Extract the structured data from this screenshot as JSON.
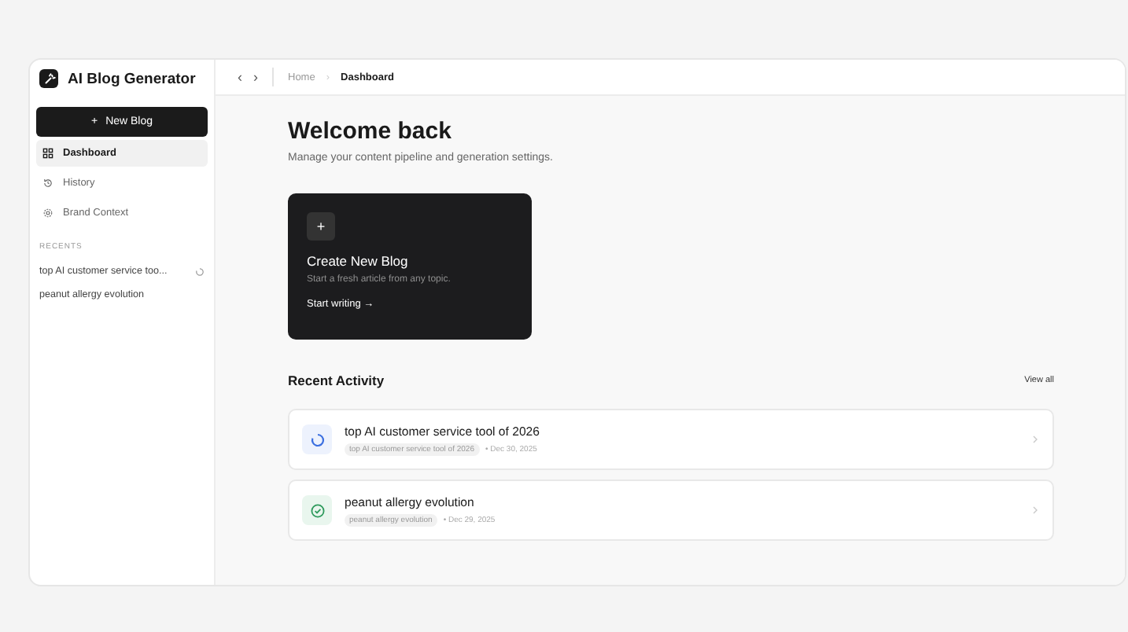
{
  "app": {
    "title": "AI Blog Generator"
  },
  "sidebar": {
    "new_button": {
      "icon": "+",
      "label": "New Blog"
    },
    "items": [
      {
        "label": "Dashboard",
        "selected": true,
        "kind": "dashboard"
      },
      {
        "label": "History",
        "selected": false,
        "kind": "history"
      },
      {
        "label": "Brand Context",
        "selected": false,
        "kind": "brand"
      }
    ],
    "recents_heading": "RECENTS",
    "recents": [
      {
        "label": "top AI customer service too...",
        "kind": "generating"
      },
      {
        "label": "peanut allergy evolution",
        "kind": "done"
      }
    ]
  },
  "topbar": {
    "back": "‹",
    "forward": "›",
    "breadcrumbs": [
      {
        "label": "Home",
        "selected": false
      },
      {
        "label": "Dashboard",
        "selected": true
      }
    ],
    "separator": "›"
  },
  "main": {
    "title": "Welcome back",
    "subtitle": "Manage your content pipeline and generation settings.",
    "create_card": {
      "icon": "+",
      "title": "Create New Blog",
      "description": "Start a fresh article from any topic.",
      "link": "Start writing",
      "link_arrow": "→"
    },
    "recent_activity": {
      "heading": "Recent Activity",
      "view_all": "View all",
      "items": [
        {
          "title": "top AI customer service tool of 2026",
          "tag": "top AI customer service tool of 2026",
          "date": "• Dec 30, 2025",
          "kind": "generating"
        },
        {
          "title": "peanut allergy evolution",
          "tag": "peanut allergy evolution",
          "date": "• Dec 29, 2025",
          "kind": "done"
        }
      ]
    }
  }
}
